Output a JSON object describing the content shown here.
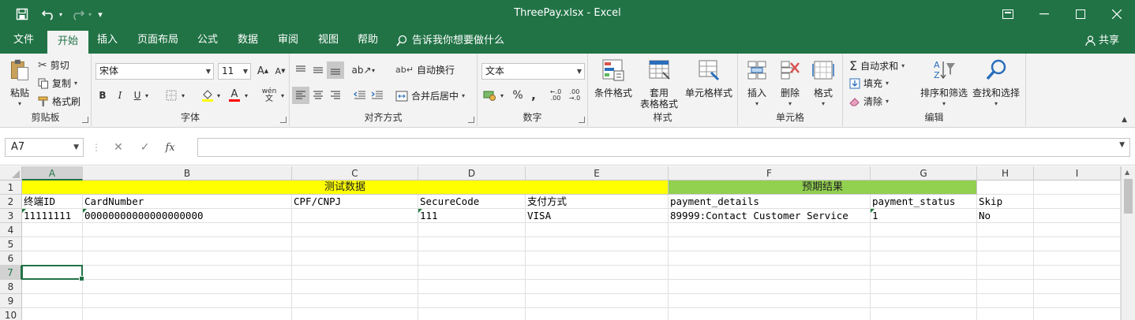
{
  "window": {
    "title": "ThreePay.xlsx  -  Excel",
    "customize_label": "▾"
  },
  "tabs": [
    {
      "label": "文件"
    },
    {
      "label": "开始"
    },
    {
      "label": "插入"
    },
    {
      "label": "页面布局"
    },
    {
      "label": "公式"
    },
    {
      "label": "数据"
    },
    {
      "label": "审阅"
    },
    {
      "label": "视图"
    },
    {
      "label": "帮助"
    }
  ],
  "tellme": "告诉我你想要做什么",
  "share": "共享",
  "ribbon": {
    "clipboard": {
      "title": "剪贴板",
      "paste": "粘贴",
      "cut": "剪切",
      "copy": "复制",
      "painter": "格式刷"
    },
    "font": {
      "title": "字体",
      "font_name": "宋体",
      "font_size": "11",
      "bold": "B",
      "italic": "I",
      "underline": "U",
      "phonetic": "wén",
      "font_color_label": "A"
    },
    "alignment": {
      "title": "对齐方式",
      "wrap": "自动换行",
      "merge": "合并后居中"
    },
    "number": {
      "title": "数字",
      "format": "文本",
      "percent": "%",
      "comma": ",",
      "inc_decimal": "←.0\n.00",
      "dec_decimal": ".00\n→.0"
    },
    "styles": {
      "title": "样式",
      "conditional": "条件格式",
      "table_line1": "套用",
      "table_line2": "表格格式",
      "cell_styles": "单元格样式"
    },
    "cells": {
      "title": "单元格",
      "insert": "插入",
      "delete": "删除",
      "format": "格式"
    },
    "editing": {
      "title": "编辑",
      "autosum": "自动求和",
      "fill": "填充",
      "clear": "清除",
      "sort": "排序和筛选",
      "find": "查找和选择"
    }
  },
  "formula_bar": {
    "name_box": "A7",
    "fx": "fx",
    "value": ""
  },
  "grid": {
    "columns": [
      "A",
      "B",
      "C",
      "D",
      "E",
      "F",
      "G",
      "H",
      "I"
    ],
    "rows": [
      "1",
      "2",
      "3",
      "4",
      "5",
      "6",
      "7",
      "8",
      "9",
      "10"
    ],
    "selected_column": "A",
    "selected_row": "7",
    "header_row1": {
      "test_data": "测试数据",
      "expected": "预期结果"
    },
    "header_row2": [
      "终端ID",
      "CardNumber",
      "CPF/CNPJ",
      "SecureCode",
      "支付方式",
      "payment_details",
      "payment_status",
      "Skip"
    ],
    "data_row3": [
      "11111111",
      "00000000000000000000",
      "",
      "111",
      "VISA",
      "89999:Contact Customer Service",
      "1",
      "No"
    ]
  },
  "colors": {
    "excel_green": "#217346",
    "yellow": "#ffff00",
    "light_green": "#92d050"
  }
}
